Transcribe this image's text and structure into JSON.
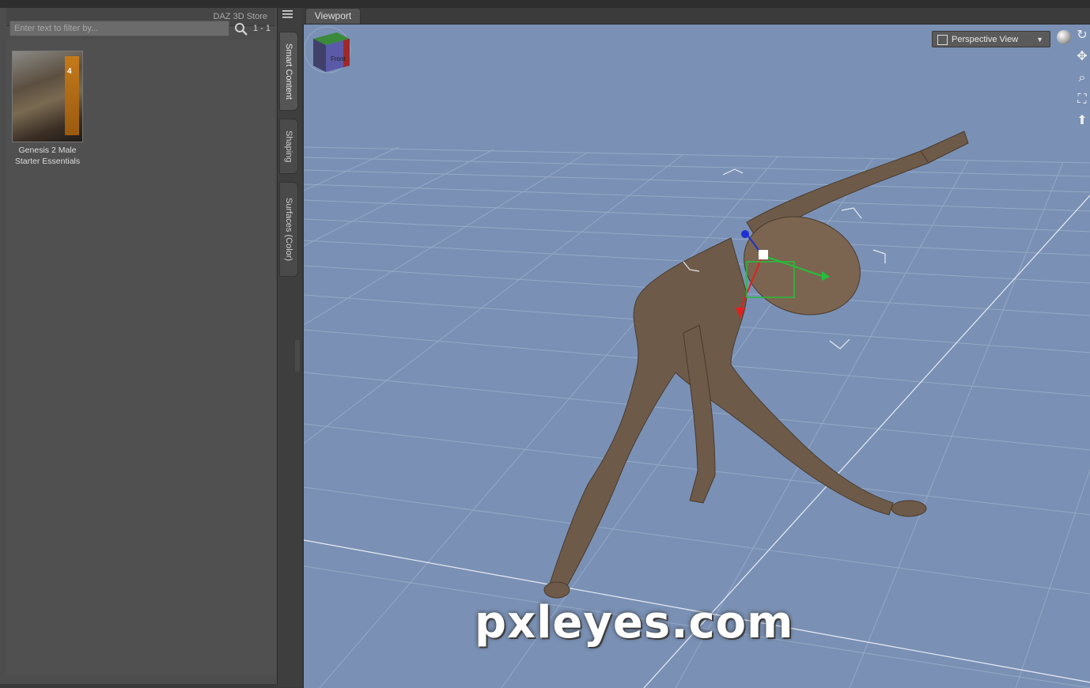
{
  "left_panel": {
    "store_tab": "DAZ 3D Store",
    "filter_placeholder": "Enter text to filter by...",
    "result_count": "1 - 1",
    "items": [
      {
        "label_line1": "Genesis 2 Male",
        "label_line2": "Starter Essentials",
        "badge": "4"
      }
    ]
  },
  "side_tabs": [
    {
      "label": "Smart Content",
      "active": true
    },
    {
      "label": "Shaping",
      "active": false
    },
    {
      "label": "Surfaces (Color)",
      "active": false
    }
  ],
  "viewport": {
    "tab_label": "Viewport",
    "view_select": "Perspective View",
    "cube_face": "Front",
    "background_color": "#7a91b5"
  },
  "watermark": "pxleyes.com"
}
